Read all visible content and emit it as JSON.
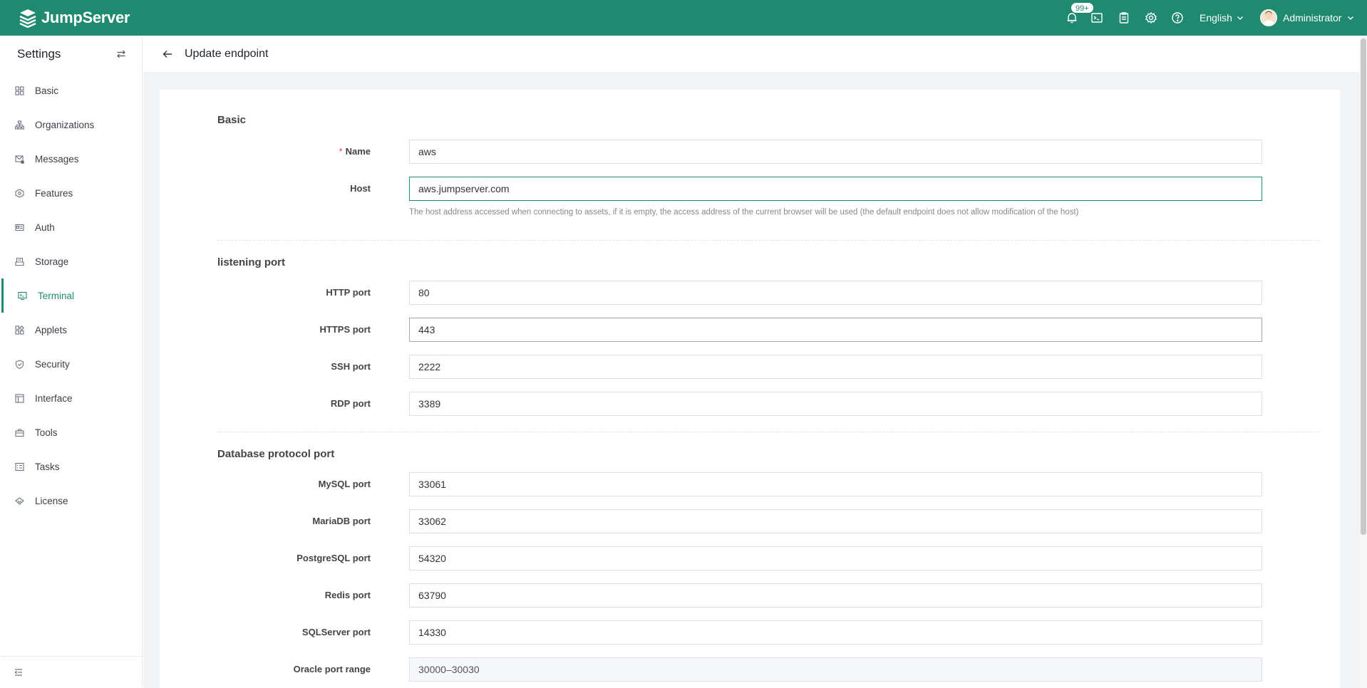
{
  "app": {
    "logo_text": "JumpServer",
    "notification_badge": "99+",
    "language": "English",
    "user_name": "Administrator"
  },
  "sidebar": {
    "title": "Settings",
    "items": [
      {
        "label": "Basic",
        "icon": "grid-icon"
      },
      {
        "label": "Organizations",
        "icon": "org-tree-icon"
      },
      {
        "label": "Messages",
        "icon": "message-icon"
      },
      {
        "label": "Features",
        "icon": "feature-icon"
      },
      {
        "label": "Auth",
        "icon": "id-card-icon"
      },
      {
        "label": "Storage",
        "icon": "storage-icon"
      },
      {
        "label": "Terminal",
        "icon": "terminal-icon",
        "active": true
      },
      {
        "label": "Applets",
        "icon": "applets-icon"
      },
      {
        "label": "Security",
        "icon": "shield-icon"
      },
      {
        "label": "Interface",
        "icon": "interface-icon"
      },
      {
        "label": "Tools",
        "icon": "toolbox-icon"
      },
      {
        "label": "Tasks",
        "icon": "tasks-icon"
      },
      {
        "label": "License",
        "icon": "license-icon"
      }
    ]
  },
  "page": {
    "title": "Update endpoint"
  },
  "form": {
    "section_basic": "Basic",
    "name_label": "Name",
    "name_value": "aws",
    "host_label": "Host",
    "host_value": "aws.jumpserver.com",
    "host_help": "The host address accessed when connecting to assets, if it is empty, the access address of the current browser will be used (the default endpoint does not allow modification of the host)",
    "section_listening": "listening port",
    "http_label": "HTTP port",
    "http_value": "80",
    "https_label": "HTTPS port",
    "https_value": "443",
    "ssh_label": "SSH port",
    "ssh_value": "2222",
    "rdp_label": "RDP port",
    "rdp_value": "3389",
    "section_db": "Database protocol port",
    "mysql_label": "MySQL port",
    "mysql_value": "33061",
    "mariadb_label": "MariaDB port",
    "mariadb_value": "33062",
    "postgres_label": "PostgreSQL port",
    "postgres_value": "54320",
    "redis_label": "Redis port",
    "redis_value": "63790",
    "sqlserver_label": "SQLServer port",
    "sqlserver_value": "14330",
    "oracle_label": "Oracle port range",
    "oracle_value": "30000–30030"
  },
  "colors": {
    "brand": "#1f8a70",
    "required": "#e03e3e"
  }
}
